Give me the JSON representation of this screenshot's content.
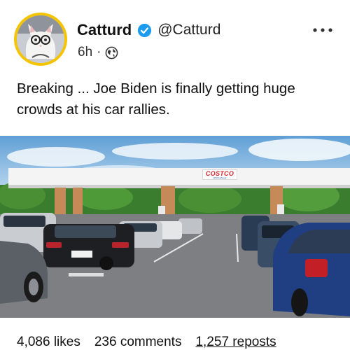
{
  "author": {
    "display_name": "Catturd",
    "handle": "@Catturd",
    "verified": true,
    "avatar_border_color": "#f5c400",
    "verified_badge_color": "#1d9bf0"
  },
  "meta": {
    "time_ago": "6h",
    "separator": "·",
    "visibility_icon": "globe-icon"
  },
  "post": {
    "text": "Breaking ... Joe Biden is finally getting huge crowds at his car rallies."
  },
  "photo": {
    "sign_text": "COSTCO",
    "sign_subtext": "WHOLESALE",
    "brand_color": "#d2242a"
  },
  "stats": {
    "likes": "4,086 likes",
    "comments": "236 comments",
    "reposts": "1,257 reposts"
  }
}
